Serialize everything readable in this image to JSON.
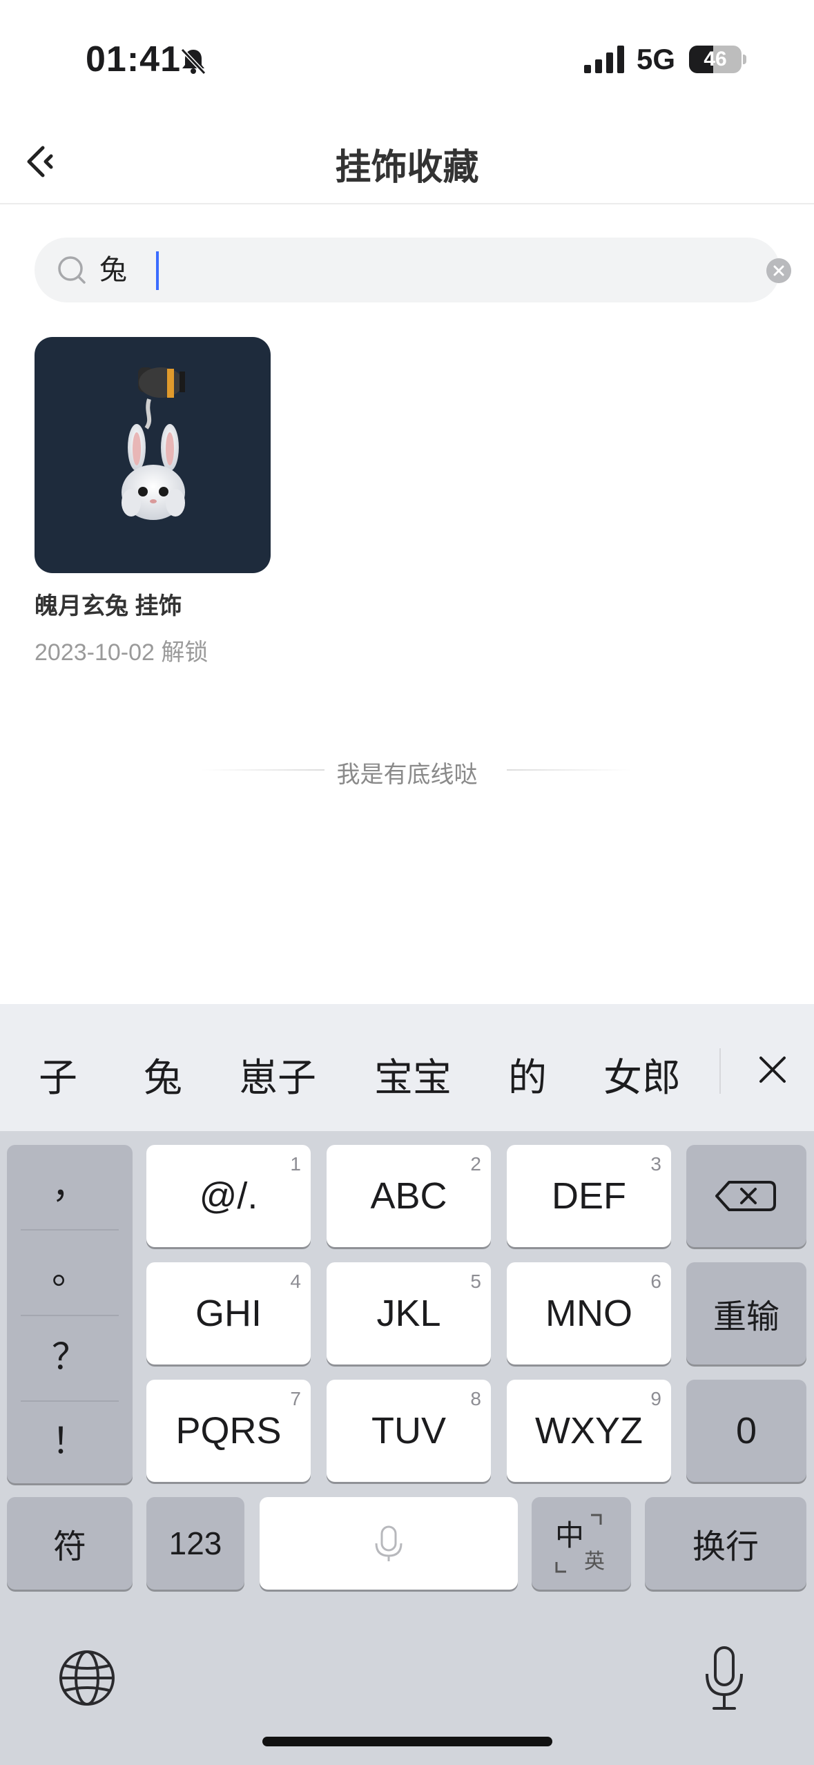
{
  "status_bar": {
    "time": "01:41",
    "network": "5G",
    "battery": "46",
    "battery_level": 0.46
  },
  "nav": {
    "title": "挂饰收藏"
  },
  "search": {
    "query": "兔"
  },
  "items": [
    {
      "name": "魄月玄兔 挂饰",
      "unlock_info": "2023-10-02 解锁"
    }
  ],
  "footer": {
    "end_text": "我是有底线哒"
  },
  "keyboard": {
    "candidates": [
      "子",
      "兔",
      "崽子",
      "宝宝",
      "的",
      "女郎"
    ],
    "punctuation": [
      "，",
      "。",
      "？",
      "！"
    ],
    "keys": [
      {
        "label": "@/.",
        "num": "1"
      },
      {
        "label": "ABC",
        "num": "2"
      },
      {
        "label": "DEF",
        "num": "3"
      },
      {
        "label": "GHI",
        "num": "4"
      },
      {
        "label": "JKL",
        "num": "5"
      },
      {
        "label": "MNO",
        "num": "6"
      },
      {
        "label": "PQRS",
        "num": "7"
      },
      {
        "label": "TUV",
        "num": "8"
      },
      {
        "label": "WXYZ",
        "num": "9"
      }
    ],
    "retype": "重输",
    "zero": "0",
    "symbols": "符",
    "numbers": "123",
    "lang_zh": "中",
    "lang_en": "英",
    "return": "换行"
  }
}
